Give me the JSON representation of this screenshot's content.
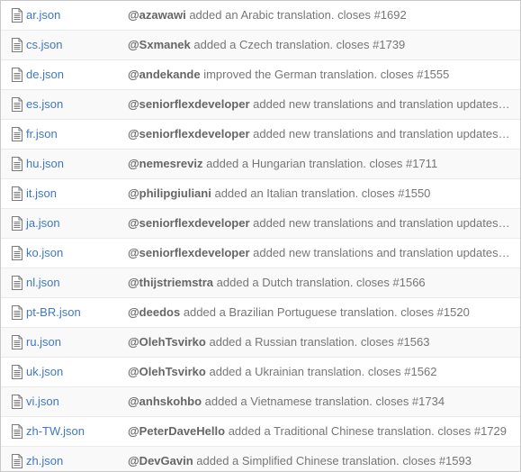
{
  "icon": "file-text-icon",
  "colors": {
    "link": "#4078c0",
    "message": "#767676",
    "border": "#eaeaea"
  },
  "files": [
    {
      "name": "ar.json",
      "author": "@azawawi",
      "message": "added an Arabic translation. closes #1692"
    },
    {
      "name": "cs.json",
      "author": "@Sxmanek",
      "message": "added a Czech translation. closes #1739"
    },
    {
      "name": "de.json",
      "author": "@andekande",
      "message": "improved the German translation. closes #1555"
    },
    {
      "name": "es.json",
      "author": "@seniorflexdeveloper",
      "message": "added new translations and translation updates. …"
    },
    {
      "name": "fr.json",
      "author": "@seniorflexdeveloper",
      "message": "added new translations and translation updates. …"
    },
    {
      "name": "hu.json",
      "author": "@nemesreviz",
      "message": "added a Hungarian translation. closes #1711"
    },
    {
      "name": "it.json",
      "author": "@philipgiuliani",
      "message": "added an Italian translation. closes #1550"
    },
    {
      "name": "ja.json",
      "author": "@seniorflexdeveloper",
      "message": "added new translations and translation updates. …"
    },
    {
      "name": "ko.json",
      "author": "@seniorflexdeveloper",
      "message": "added new translations and translation updates. …"
    },
    {
      "name": "nl.json",
      "author": "@thijstriemstra",
      "message": "added a Dutch translation. closes #1566"
    },
    {
      "name": "pt-BR.json",
      "author": "@deedos",
      "message": "added a Brazilian Portuguese translation. closes #1520"
    },
    {
      "name": "ru.json",
      "author": "@OlehTsvirko",
      "message": "added a Russian translation. closes #1563"
    },
    {
      "name": "uk.json",
      "author": "@OlehTsvirko",
      "message": "added a Ukrainian translation. closes #1562"
    },
    {
      "name": "vi.json",
      "author": "@anhskohbo",
      "message": "added a Vietnamese translation. closes #1734"
    },
    {
      "name": "zh-TW.json",
      "author": "@PeterDaveHello",
      "message": "added a Traditional Chinese translation. closes #1729"
    },
    {
      "name": "zh.json",
      "author": "@DevGavin",
      "message": "added a Simplified Chinese translation. closes #1593"
    }
  ]
}
